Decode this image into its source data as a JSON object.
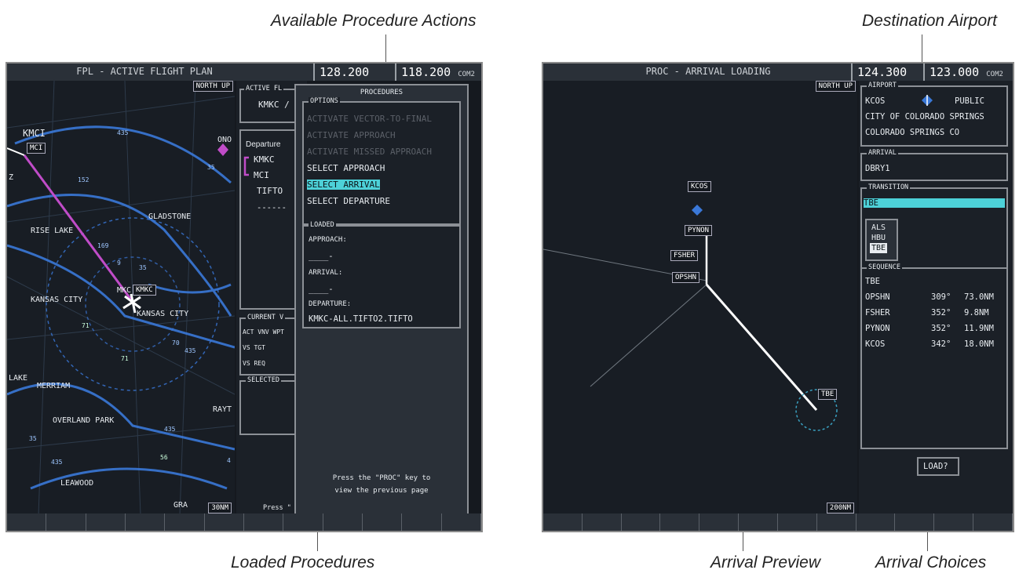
{
  "callouts": {
    "available_actions": "Available Procedure Actions",
    "loaded_procedures": "Loaded Procedures",
    "destination_airport": "Destination Airport",
    "arrival_preview": "Arrival Preview",
    "arrival_choices": "Arrival Choices"
  },
  "left_screen": {
    "title": "FPL - ACTIVE FLIGHT PLAN",
    "freq_active": "128.200",
    "freq_standby": "118.200",
    "com_label": "COM2",
    "orientation": "NORTH UP",
    "range": "30NM",
    "map_labels": {
      "kmci": "KMCI",
      "mci": "MCI",
      "gladstone": "GLADSTONE",
      "riverside": "RISE LAKE",
      "kansas_city_w": "KANSAS CITY",
      "kansas_city_e": "KANSAS CITY",
      "kmkc": "KMKC",
      "mkc_prefix": "MKC",
      "merriam": "MERRIAM",
      "overland_park": "OVERLAND PARK",
      "leawood": "LEAWOOD",
      "raytown": "RAYT",
      "lake": "LAKE",
      "gra": "GRA",
      "ono": "ONO",
      "z": "Z",
      "hw_435a": "435",
      "hw_152": "152",
      "hw_169": "169",
      "hw_35a": "35",
      "hw_9": "9",
      "hw_35b": "35",
      "hw_70": "70",
      "hw_435b": "435",
      "hw_435c": "435",
      "hw_435d": "435",
      "hw_35c": "35",
      "hw_us_a": "71",
      "hw_us_b": "71",
      "hw_us_c": "56",
      "hw_4": "4"
    },
    "fpl": {
      "active_title": "ACTIVE FL",
      "active_route": "KMKC /",
      "departure_header": "Departure",
      "waypoints": [
        "KMKC",
        "MCI",
        "TIFTO"
      ],
      "dashes": "------",
      "current_title": "CURRENT V",
      "act_vnv": "ACT VNV WPT",
      "vs_tgt": "VS TGT",
      "vs_req": "VS REQ",
      "selected_title": "SELECTED",
      "press_hint": "Press \""
    },
    "procedures": {
      "title": "PROCEDURES",
      "options_title": "OPTIONS",
      "options": [
        {
          "label": "ACTIVATE VECTOR-TO-FINAL",
          "state": "disabled"
        },
        {
          "label": "ACTIVATE APPROACH",
          "state": "disabled"
        },
        {
          "label": "ACTIVATE MISSED APPROACH",
          "state": "disabled"
        },
        {
          "label": "SELECT APPROACH",
          "state": "enabled"
        },
        {
          "label": "SELECT ARRIVAL",
          "state": "selected"
        },
        {
          "label": "SELECT DEPARTURE",
          "state": "enabled"
        }
      ],
      "loaded_title": "LOADED",
      "approach_label": "APPROACH:",
      "approach_value": "____-",
      "arrival_label": "ARRIVAL:",
      "arrival_value": "____-",
      "departure_label": "DEPARTURE:",
      "departure_value": "KMKC-ALL.TIFTO2.TIFTO",
      "hint_line1": "Press the \"PROC\" key to",
      "hint_line2": "view the previous page"
    }
  },
  "right_screen": {
    "title": "PROC - ARRIVAL LOADING",
    "freq_active": "124.300",
    "freq_standby": "123.000",
    "com_label": "COM2",
    "orientation": "NORTH UP",
    "range": "200NM",
    "map_waypoints": {
      "kcos": "KCOS",
      "pynon": "PYNON",
      "fsher": "FSHER",
      "opshn": "OPSHN",
      "tbe": "TBE"
    },
    "airport": {
      "title": "AIRPORT",
      "id": "KCOS",
      "type": "PUBLIC",
      "name": "CITY OF COLORADO SPRINGS",
      "city": "COLORADO SPRINGS CO"
    },
    "arrival": {
      "title": "ARRIVAL",
      "value": "DBRY1"
    },
    "transition": {
      "title": "TRANSITION",
      "value": "TBE",
      "options": [
        "ALS",
        "HBU",
        "TBE"
      ],
      "selected_index": 2
    },
    "sequence_title": "SEQUENCE",
    "sequence": [
      {
        "wpt": "TBE",
        "dtk": "",
        "dist": ""
      },
      {
        "wpt": "OPSHN",
        "dtk": "309°",
        "dist": "73.0NM"
      },
      {
        "wpt": "FSHER",
        "dtk": "352°",
        "dist": "9.8NM"
      },
      {
        "wpt": "PYNON",
        "dtk": "352°",
        "dist": "11.9NM"
      },
      {
        "wpt": "KCOS",
        "dtk": "342°",
        "dist": "18.0NM"
      }
    ],
    "load_button": "LOAD?"
  },
  "colors": {
    "highlight": "#4dd1d8",
    "range_ring": "#3a78d8",
    "route": "#c04cc8",
    "map_bg": "#15191f"
  }
}
